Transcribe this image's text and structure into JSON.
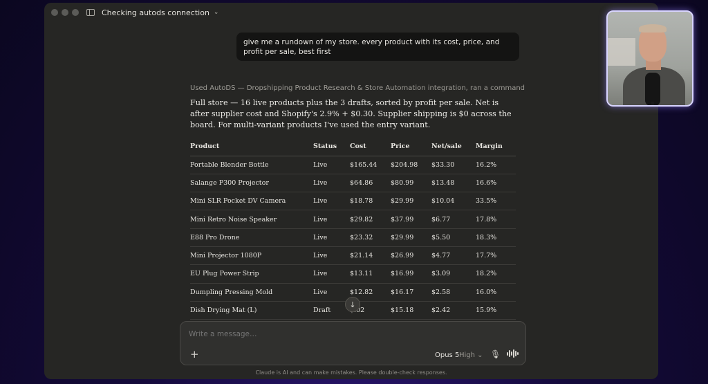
{
  "window": {
    "conversation_title": "Checking autods connection"
  },
  "conversation": {
    "user_message": "give me a rundown of my store. every product with its cost, price, and profit per sale, best first",
    "tool_usage": "Used AutoDS — Dropshipping Product Research & Store Automation integration, ran a command",
    "assistant_intro": "Full store — 16 live products plus the 3 drafts, sorted by profit per sale. Net is after supplier cost and Shopify's 2.9% + $0.30. Supplier shipping is $0 across the board. For multi-variant products I've used the entry variant.",
    "table": {
      "headers": [
        "Product",
        "Status",
        "Cost",
        "Price",
        "Net/sale",
        "Margin"
      ],
      "rows": [
        [
          "Portable Blender Bottle",
          "Live",
          "$165.44",
          "$204.98",
          "$33.30",
          "16.2%"
        ],
        [
          "Salange P300 Projector",
          "Live",
          "$64.86",
          "$80.99",
          "$13.48",
          "16.6%"
        ],
        [
          "Mini SLR Pocket DV Camera",
          "Live",
          "$18.78",
          "$29.99",
          "$10.04",
          "33.5%"
        ],
        [
          "Mini Retro Noise Speaker",
          "Live",
          "$29.82",
          "$37.99",
          "$6.77",
          "17.8%"
        ],
        [
          "E88 Pro Drone",
          "Live",
          "$23.32",
          "$29.99",
          "$5.50",
          "18.3%"
        ],
        [
          "Mini Projector 1080P",
          "Live",
          "$21.14",
          "$26.99",
          "$4.77",
          "17.7%"
        ],
        [
          "EU Plug Power Strip",
          "Live",
          "$13.11",
          "$16.99",
          "$3.09",
          "18.2%"
        ],
        [
          "Dumpling Pressing Mold",
          "Live",
          "$12.82",
          "$16.17",
          "$2.58",
          "16.0%"
        ],
        [
          "Dish Drying Mat (L)",
          "Draft",
          "$.02",
          "$15.18",
          "$2.42",
          "15.9%"
        ]
      ]
    }
  },
  "composer": {
    "placeholder": "Write a message…",
    "model": "Opus 5",
    "effort": "High"
  },
  "footer": {
    "disclaimer": "Claude is AI and can make mistakes. Please double-check responses."
  },
  "icons": {
    "sidebar": "sidebar-toggle-icon",
    "scroll": "arrow-down-icon",
    "add": "plus-icon",
    "mic": "microphone-icon",
    "voice": "voice-waveform-icon"
  },
  "colors": {
    "window_bg": "#262624",
    "bubble_bg": "#141413",
    "composer_bg": "#30302e",
    "webcam_border": "#d8d4ff"
  }
}
